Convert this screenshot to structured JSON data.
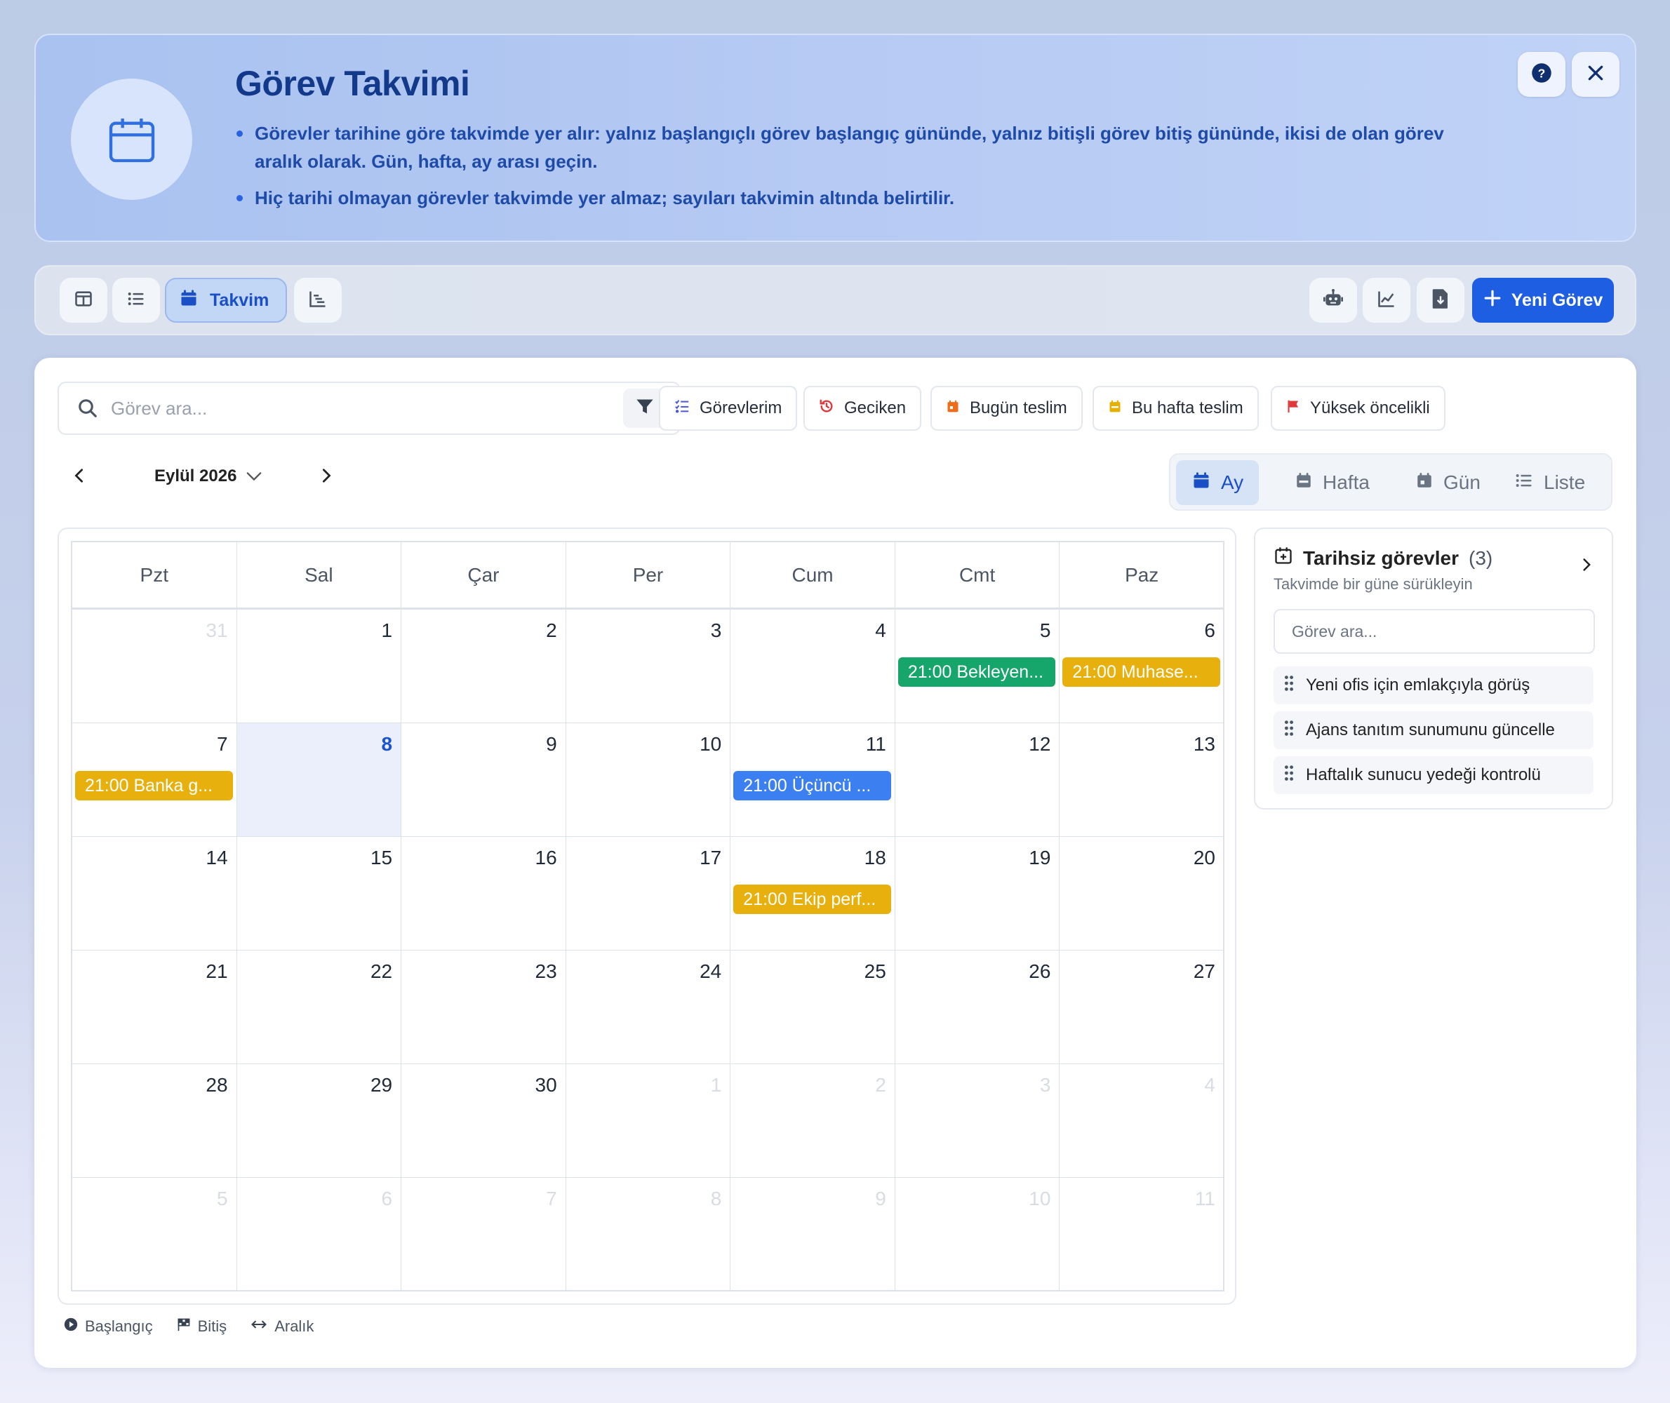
{
  "banner": {
    "title": "Görev Takvimi",
    "bullets": [
      "Görevler tarihine göre takvimde yer alır: yalnız başlangıçlı görev başlangıç gününde, yalnız bitişli görev bitiş gününde, ikisi de olan görev aralık olarak. Gün, hafta, ay arası geçin.",
      "Hiç tarihi olmayan görevler takvimde yer almaz; sayıları takvimin altında belirtilir."
    ],
    "icon": "calendar-icon",
    "help_icon": "help-icon",
    "close_icon": "close-icon"
  },
  "toolbar": {
    "views": [
      {
        "icon": "board-icon"
      },
      {
        "icon": "list-icon"
      },
      {
        "icon": "calendar-icon",
        "label": "Takvim",
        "active": true
      },
      {
        "icon": "gantt-icon"
      }
    ],
    "right_icons": [
      "robot-icon",
      "chart-line-icon",
      "file-download-icon"
    ],
    "new_task_label": "Yeni Görev"
  },
  "filters": {
    "search_placeholder": "Görev ara...",
    "chips": [
      {
        "label": "Görevlerim",
        "icon": "tasks-icon",
        "color": "#4a57d6"
      },
      {
        "label": "Geciken",
        "icon": "history-icon",
        "color": "#e0373a"
      },
      {
        "label": "Bugün teslim",
        "icon": "calendar-day-icon",
        "color": "#ef6c1a"
      },
      {
        "label": "Bu hafta teslim",
        "icon": "calendar-week-icon",
        "color": "#e6b000"
      },
      {
        "label": "Yüksek öncelikli",
        "icon": "flag-icon",
        "color": "#e0373a"
      }
    ]
  },
  "calendar": {
    "month_label": "Eylül 2026",
    "view_modes": [
      {
        "label": "Ay",
        "active": true
      },
      {
        "label": "Hafta",
        "active": false
      },
      {
        "label": "Gün",
        "active": false
      },
      {
        "label": "Liste",
        "active": false
      }
    ],
    "weekdays": [
      "Pzt",
      "Sal",
      "Çar",
      "Per",
      "Cum",
      "Cmt",
      "Paz"
    ],
    "weeks": [
      [
        {
          "d": "31",
          "m": true
        },
        {
          "d": "1"
        },
        {
          "d": "2"
        },
        {
          "d": "3"
        },
        {
          "d": "4"
        },
        {
          "d": "5"
        },
        {
          "d": "6"
        }
      ],
      [
        {
          "d": "7"
        },
        {
          "d": "8",
          "today": true
        },
        {
          "d": "9"
        },
        {
          "d": "10"
        },
        {
          "d": "11"
        },
        {
          "d": "12"
        },
        {
          "d": "13"
        }
      ],
      [
        {
          "d": "14"
        },
        {
          "d": "15"
        },
        {
          "d": "16"
        },
        {
          "d": "17"
        },
        {
          "d": "18"
        },
        {
          "d": "19"
        },
        {
          "d": "20"
        }
      ],
      [
        {
          "d": "21"
        },
        {
          "d": "22"
        },
        {
          "d": "23"
        },
        {
          "d": "24"
        },
        {
          "d": "25"
        },
        {
          "d": "26"
        },
        {
          "d": "27"
        }
      ],
      [
        {
          "d": "28"
        },
        {
          "d": "29"
        },
        {
          "d": "30"
        },
        {
          "d": "1",
          "m": true
        },
        {
          "d": "2",
          "m": true
        },
        {
          "d": "3",
          "m": true
        },
        {
          "d": "4",
          "m": true
        }
      ],
      [
        {
          "d": "5",
          "m": true
        },
        {
          "d": "6",
          "m": true
        },
        {
          "d": "7",
          "m": true
        },
        {
          "d": "8",
          "m": true
        },
        {
          "d": "9",
          "m": true
        },
        {
          "d": "10",
          "m": true
        },
        {
          "d": "11",
          "m": true
        }
      ]
    ],
    "events": [
      {
        "week": 0,
        "day": 5,
        "label": "21:00 Bekleyen...",
        "color": "#16a56a"
      },
      {
        "week": 0,
        "day": 6,
        "label": "21:00 Muhase...",
        "color": "#e8b00c"
      },
      {
        "week": 1,
        "day": 0,
        "label": "21:00 Banka g...",
        "color": "#e8b00c"
      },
      {
        "week": 1,
        "day": 4,
        "label": "21:00 Üçüncü ...",
        "color": "#3b7ff0"
      },
      {
        "week": 2,
        "day": 4,
        "label": "21:00 Ekip perf...",
        "color": "#e8b00c"
      }
    ],
    "legend": [
      {
        "label": "Başlangıç",
        "icon": "play-circle-icon"
      },
      {
        "label": "Bitiş",
        "icon": "flag-checkered-icon"
      },
      {
        "label": "Aralık",
        "icon": "arrows-horizontal-icon"
      }
    ]
  },
  "unscheduled": {
    "title": "Tarihsiz görevler",
    "count": "(3)",
    "subtitle": "Takvimde bir güne sürükleyin",
    "search_placeholder": "Görev ara...",
    "items": [
      "Yeni ofis için emlakçıyla görüş",
      "Ajans tanıtım sunumunu güncelle",
      "Haftalık sunucu yedeği kontrolü"
    ]
  }
}
